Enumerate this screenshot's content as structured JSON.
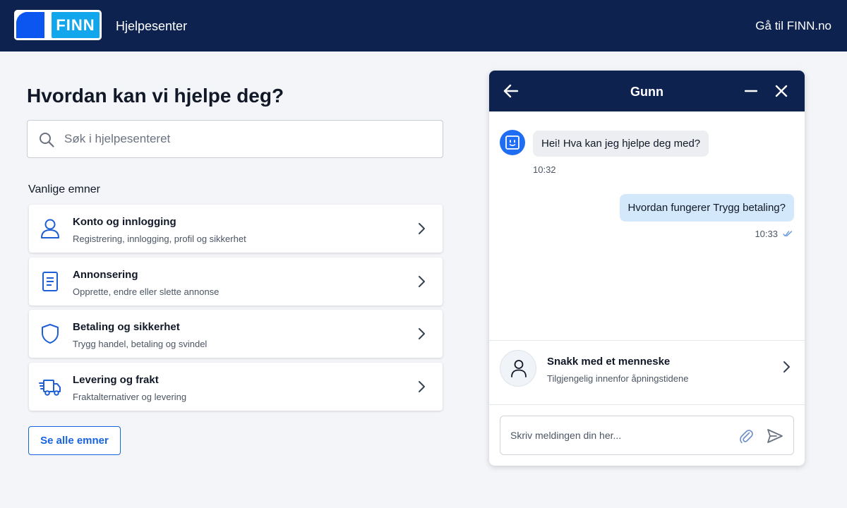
{
  "header": {
    "logo_text": "FINN",
    "site_title": "Hjelpesenter",
    "goto_link": "Gå til FINN.no"
  },
  "main": {
    "title": "Hvordan kan vi hjelpe deg?",
    "search": {
      "placeholder": "Søk i hjelpesenteret",
      "value": ""
    },
    "section_label": "Vanlige emner",
    "topics": [
      {
        "icon": "user-icon",
        "title": "Konto og innlogging",
        "subtitle": "Registrering, innlogging, profil og sikkerhet"
      },
      {
        "icon": "document-icon",
        "title": "Annonsering",
        "subtitle": "Opprette, endre eller slette annonse"
      },
      {
        "icon": "shield-icon",
        "title": "Betaling og sikkerhet",
        "subtitle": "Trygg handel, betaling og svindel"
      },
      {
        "icon": "truck-icon",
        "title": "Levering og frakt",
        "subtitle": "Fraktalternativer og levering"
      }
    ],
    "see_all_label": "Se alle emner"
  },
  "chat": {
    "agent_name": "Gunn",
    "messages": [
      {
        "from": "bot",
        "text": "Hei! Hva kan jeg hjelpe deg med?",
        "time": "10:32"
      },
      {
        "from": "user",
        "text": "Hvordan fungerer Trygg betaling?",
        "time": "10:33",
        "status": "read"
      }
    ],
    "human": {
      "title": "Snakk med et menneske",
      "subtitle": "Tilgjengelig innenfor åpningstidene"
    },
    "composer": {
      "placeholder": "Skriv meldingen din her...",
      "value": ""
    }
  },
  "colors": {
    "header_bg": "#0e2250",
    "brand_blue": "#0b56f0",
    "brand_light_blue": "#12a7ec",
    "link_blue": "#1863e0",
    "user_bubble": "#d3e8fb",
    "bot_bubble": "#eceef1",
    "page_bg": "#f4f5f8"
  }
}
